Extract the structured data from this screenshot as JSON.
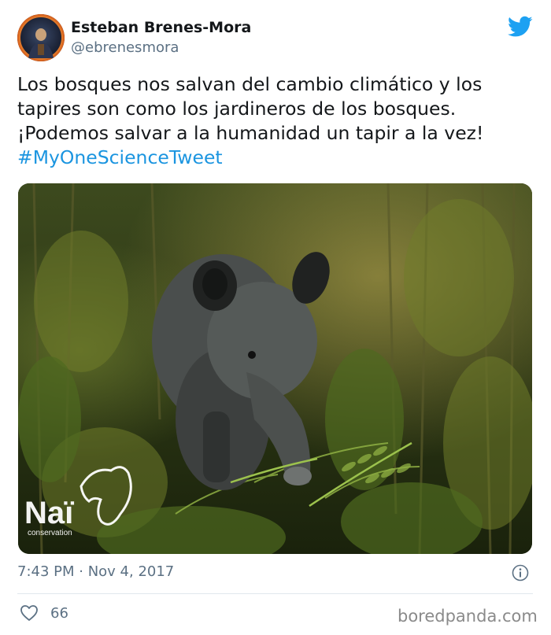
{
  "author": {
    "name": "Esteban Brenes-Mora",
    "handle": "@ebrenesmora"
  },
  "tweet": {
    "lines": [
      "Los bosques nos salvan del cambio climático y los",
      "tapires son como los jardineros de los bosques.",
      "¡Podemos salvar a la humanidad un tapir a la vez!"
    ],
    "hashtag": "#MyOneScienceTweet",
    "hashtag_color": "#1b95e0"
  },
  "media": {
    "logo_text": "Naï",
    "logo_subtext": "conservation"
  },
  "meta": {
    "time": "7:43 PM · Nov 4, 2017"
  },
  "stats": {
    "likes": "66"
  },
  "icons": {
    "platform": "twitter-bird-icon",
    "info": "info-icon",
    "like": "heart-icon"
  },
  "colors": {
    "brand": "#1da1f2",
    "secondary_text": "#5b7083",
    "divider": "#e1e8ed"
  },
  "watermark": "boredpanda.com"
}
